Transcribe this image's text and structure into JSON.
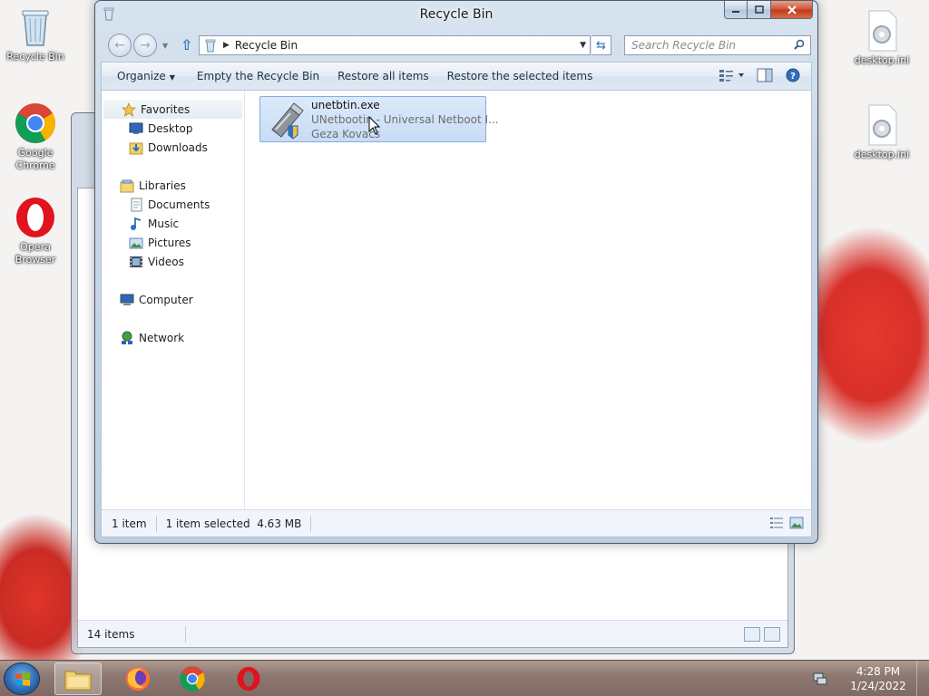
{
  "desktop": {
    "icons": [
      {
        "label": "Recycle Bin"
      },
      {
        "label": "Google Chrome"
      },
      {
        "label": "Opera Browser"
      },
      {
        "label": "desktop.ini"
      },
      {
        "label": "desktop.ini"
      }
    ]
  },
  "back_window": {
    "status_count": "14 items"
  },
  "window": {
    "title": "Recycle Bin",
    "address_path": "Recycle Bin",
    "search_placeholder": "Search Recycle Bin",
    "commands": {
      "organize": "Organize",
      "empty": "Empty the Recycle Bin",
      "restore_all": "Restore all items",
      "restore_selected": "Restore the selected items"
    },
    "nav": {
      "favorites": "Favorites",
      "desktop": "Desktop",
      "downloads": "Downloads",
      "libraries": "Libraries",
      "documents": "Documents",
      "music": "Music",
      "pictures": "Pictures",
      "videos": "Videos",
      "computer": "Computer",
      "network": "Network"
    },
    "file": {
      "name": "unetbtin.exe",
      "description": "UNetbootin - Universal Netboot I...",
      "company": "Geza Kovacs"
    },
    "status": {
      "count": "1 item",
      "selected": "1 item selected",
      "size": "4.63 MB"
    }
  },
  "taskbar": {
    "time": "4:28 PM",
    "date": "1/24/2022"
  },
  "colors": {
    "accent_selection": "#c7dcf5",
    "close_button": "#c13a1b",
    "taskbar": "#8f7a73"
  }
}
